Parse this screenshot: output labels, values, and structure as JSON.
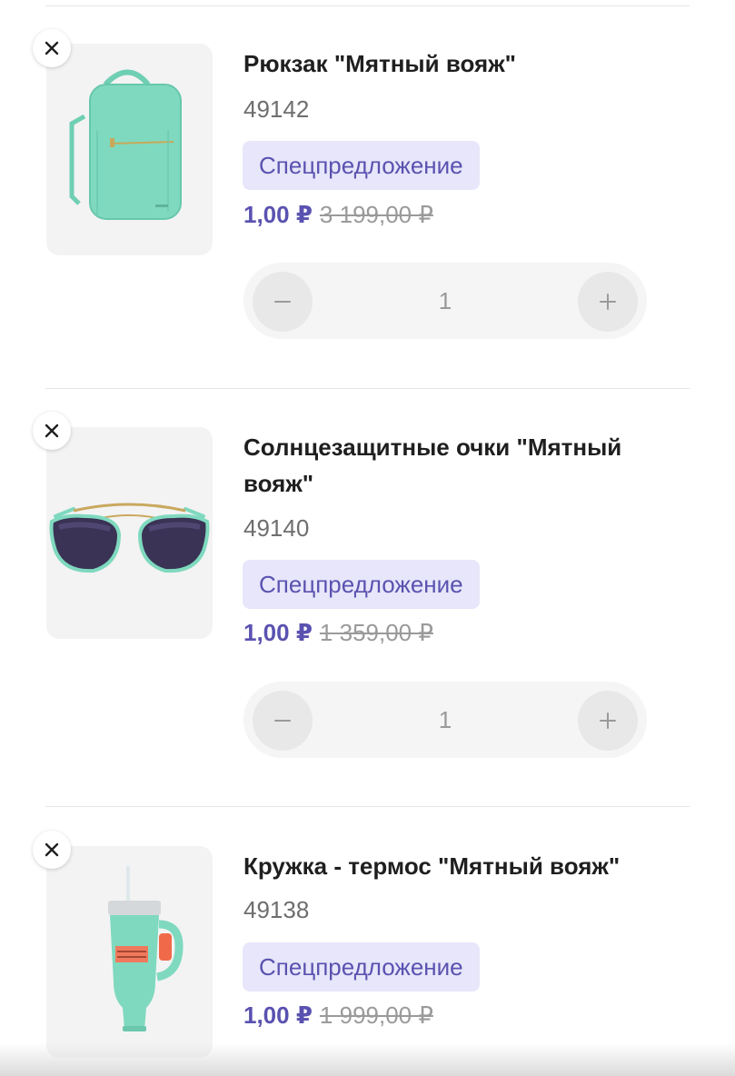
{
  "cart": {
    "items": [
      {
        "name": "Рюкзак \"Мятный вояж\"",
        "sku": "49142",
        "badge": "Спецпредложение",
        "price": "1,00 ₽",
        "old_price": "3 199,00 ₽",
        "quantity": "1",
        "image_icon": "backpack-icon"
      },
      {
        "name": "Солнцезащитные очки \"Мятный вояж\"",
        "sku": "49140",
        "badge": "Спецпредложение",
        "price": "1,00 ₽",
        "old_price": "1 359,00 ₽",
        "quantity": "1",
        "image_icon": "sunglasses-icon"
      },
      {
        "name": "Кружка - термос \"Мятный вояж\"",
        "sku": "49138",
        "badge": "Спецпредложение",
        "price": "1,00 ₽",
        "old_price": "1 999,00 ₽",
        "quantity": "1",
        "image_icon": "tumbler-icon"
      }
    ]
  },
  "colors": {
    "accent": "#5a52b0",
    "badge_bg": "#e7e6fa",
    "product_mint": "#7fd9bf"
  }
}
